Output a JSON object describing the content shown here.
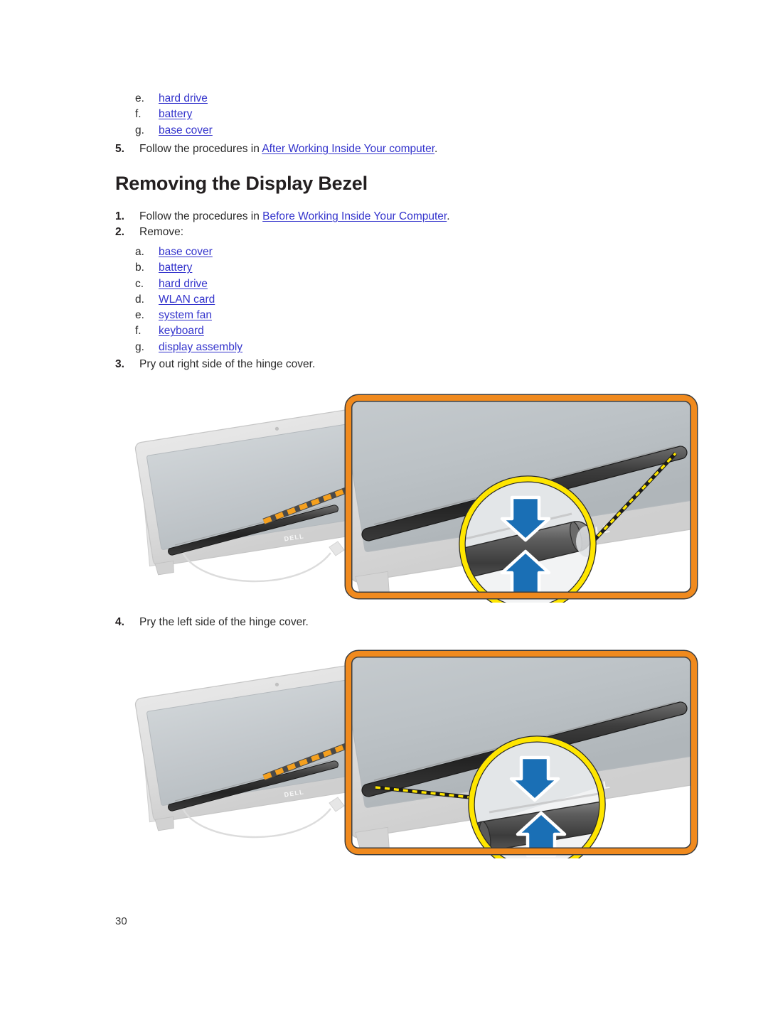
{
  "document": {
    "page_number": "30",
    "heading": "Removing the Display Bezel",
    "link_color": "#3333cc",
    "text_color": "#231f20"
  },
  "prev_section": {
    "sub_items": [
      {
        "marker": "e.",
        "label": "hard drive",
        "is_link": true
      },
      {
        "marker": "f.",
        "label": "battery",
        "is_link": true
      },
      {
        "marker": "g.",
        "label": "base cover",
        "is_link": true
      }
    ],
    "step5": {
      "marker": "5.",
      "text_before": "Follow the procedures in ",
      "link": "After Working Inside Your computer",
      "text_after": "."
    }
  },
  "section": {
    "step1": {
      "marker": "1.",
      "text_before": "Follow the procedures in ",
      "link": "Before Working Inside Your Computer",
      "text_after": "."
    },
    "step2": {
      "marker": "2.",
      "text": "Remove:"
    },
    "remove_items": [
      {
        "marker": "a.",
        "label": "base cover",
        "is_link": true
      },
      {
        "marker": "b.",
        "label": "battery",
        "is_link": true
      },
      {
        "marker": "c.",
        "label": "hard drive",
        "is_link": true
      },
      {
        "marker": "d.",
        "label": "WLAN card",
        "is_link": true
      },
      {
        "marker": "e.",
        "label": "system fan",
        "is_link": true
      },
      {
        "marker": "f.",
        "label": "keyboard",
        "is_link": true
      },
      {
        "marker": "g.",
        "label": "display assembly",
        "is_link": true
      }
    ],
    "step3": {
      "marker": "3.",
      "text": "Pry out right side of the hinge cover."
    },
    "step4": {
      "marker": "4.",
      "text": "Pry the left side of the hinge cover."
    }
  },
  "figures": [
    {
      "name": "figure-pry-right-hinge-cover",
      "alt": "Display assembly with hinge cover and magnified inset showing blue arrows pressing the right side of the hinge cover",
      "brand_logo": "DELL",
      "callout_line_color": "#F5A01E",
      "inset_border_color": "#F08A1E",
      "magnifier_ring_color": "#FFE600",
      "arrow_color": "#1A6FB5",
      "leader_side": "right"
    },
    {
      "name": "figure-pry-left-hinge-cover",
      "alt": "Display assembly with hinge cover and magnified inset showing blue arrows pressing the left side of the hinge cover",
      "brand_logo": "DELL",
      "callout_line_color": "#F5A01E",
      "inset_border_color": "#F08A1E",
      "magnifier_ring_color": "#FFE600",
      "arrow_color": "#1A6FB5",
      "leader_side": "left"
    }
  ]
}
